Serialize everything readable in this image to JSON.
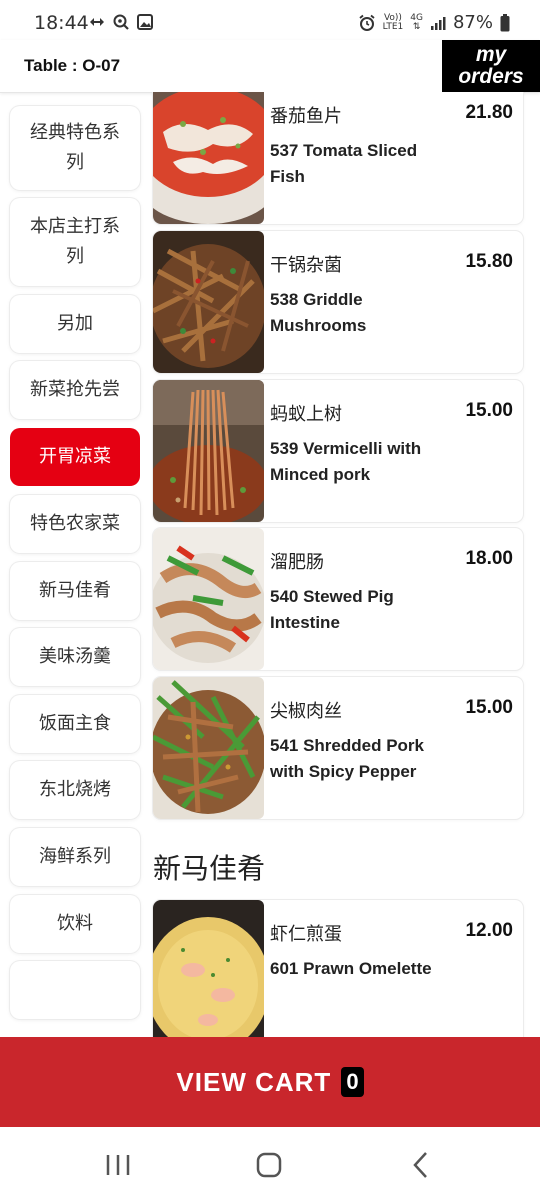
{
  "status_bar": {
    "time": "18:44",
    "net_top": "Vo))",
    "net_bottom": "LTE1",
    "signal_type": "4G",
    "battery": "87%"
  },
  "header": {
    "table": "Table : O-07",
    "orders_line1": "my",
    "orders_line2": "orders"
  },
  "categories": [
    {
      "label": "经典特色系列",
      "active": false
    },
    {
      "label": "本店主打系列",
      "active": false
    },
    {
      "label": "另加",
      "active": false
    },
    {
      "label": "新菜抢先尝",
      "active": false
    },
    {
      "label": "开胃凉菜",
      "active": true
    },
    {
      "label": "特色农家菜",
      "active": false
    },
    {
      "label": "新马佳肴",
      "active": false
    },
    {
      "label": "美味汤羹",
      "active": false
    },
    {
      "label": "饭面主食",
      "active": false
    },
    {
      "label": "东北烧烤",
      "active": false
    },
    {
      "label": "海鲜系列",
      "active": false
    },
    {
      "label": "饮料",
      "active": false
    }
  ],
  "dishes": [
    {
      "cn": "番茄鱼片",
      "en": "537 Tomata Sliced Fish",
      "price": "21.80"
    },
    {
      "cn": "干锅杂菌",
      "en": "538 Griddle Mushrooms",
      "price": "15.80"
    },
    {
      "cn": "蚂蚁上树",
      "en": "539 Vermicelli with Minced pork",
      "price": "15.00"
    },
    {
      "cn": "溜肥肠",
      "en": "540 Stewed Pig Intestine",
      "price": "18.00"
    },
    {
      "cn": "尖椒肉丝",
      "en": "541 Shredded Pork with Spicy Pepper",
      "price": "15.00"
    }
  ],
  "section": {
    "title": "新马佳肴",
    "dishes": [
      {
        "cn": "虾仁煎蛋",
        "en": "601 Prawn Omelette",
        "price": "12.00"
      }
    ]
  },
  "cart": {
    "label": "VIEW CART",
    "count": "0"
  },
  "colors": {
    "accent_red": "#e50012",
    "cart_red": "#c9262c"
  }
}
